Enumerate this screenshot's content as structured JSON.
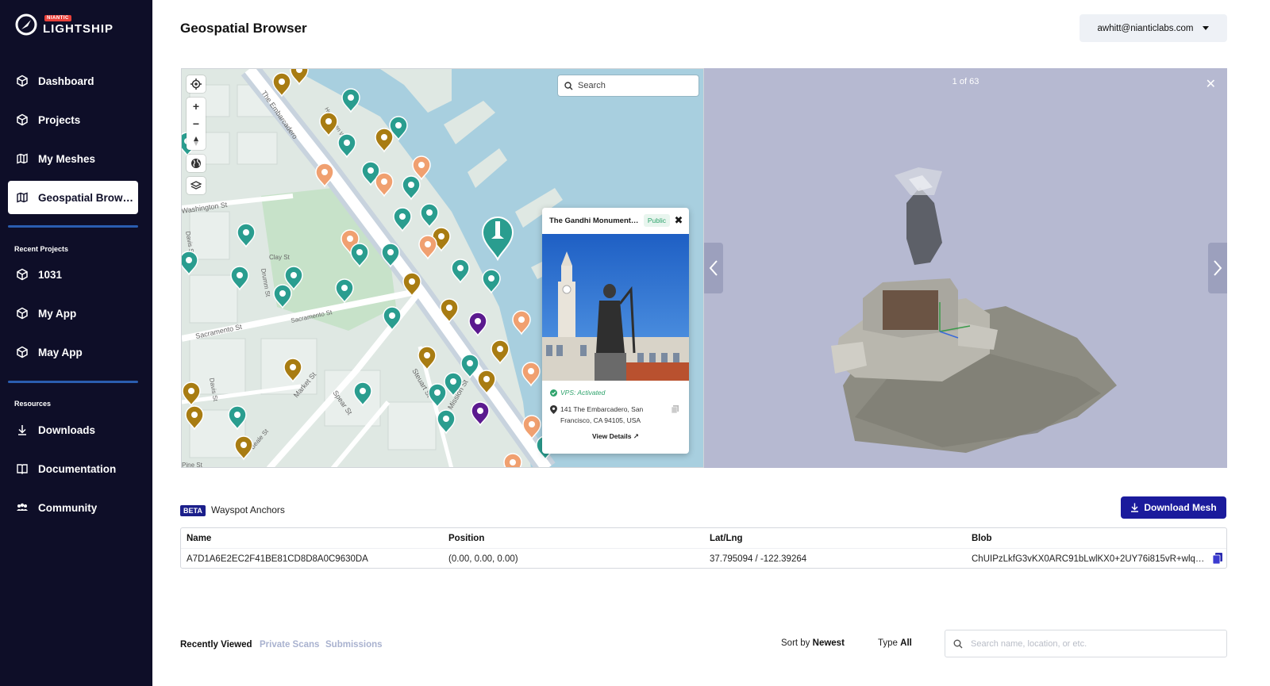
{
  "brand": {
    "sup": "NIANTIC",
    "name": "LIGHTSHIP"
  },
  "nav": {
    "dashboard": "Dashboard",
    "projects": "Projects",
    "my_meshes": "My Meshes",
    "geospatial": "Geospatial Browser"
  },
  "recent_projects": {
    "title": "Recent Projects",
    "items": [
      "1031",
      "My App",
      "May App"
    ]
  },
  "resources": {
    "title": "Resources",
    "downloads": "Downloads",
    "documentation": "Documentation",
    "community": "Community"
  },
  "header": {
    "title": "Geospatial Browser",
    "account": "awhitt@nianticlabs.com"
  },
  "map": {
    "search_placeholder": "Search",
    "streets": [
      "The Embarcadero",
      "Herb Caen Way",
      "Washington St",
      "Davis St",
      "Clay St",
      "Drumm St",
      "Sacramento St",
      "Market St",
      "Spear St",
      "Steuart St",
      "Mission St",
      "Beale St",
      "Pine St"
    ]
  },
  "popup": {
    "title": "The Gandhi Monument a...",
    "badge": "Public",
    "vps": "VPS: Activated",
    "address": "141 The Embarcadero, San Francisco, CA 94105, USA",
    "view_details": "View Details"
  },
  "viewer": {
    "count": "1 of 63"
  },
  "anchors": {
    "beta": "BETA",
    "title": "Wayspot Anchors",
    "download": "Download Mesh",
    "columns": [
      "Name",
      "Position",
      "Lat/Lng",
      "Blob"
    ],
    "row": {
      "name": "A7D1A6E2EC2F41BE81CD8D8A0C9630DA",
      "position": "(0.00, 0.00, 0.00)",
      "latlng": "37.795094 / -122.39264",
      "blob": "ChUIPzLkfG3vKX0ARC91bLwlKX0+2UY76i815vR+wlqKA..."
    }
  },
  "bottom": {
    "tabs": [
      "Recently Viewed",
      "Private Scans",
      "Submissions"
    ],
    "sort_label": "Sort by",
    "sort_value": "Newest",
    "type_label": "Type",
    "type_value": "All",
    "search_placeholder": "Search name, location, or etc."
  },
  "colors": {
    "sidebar": "#0e0e28",
    "teal_pin": "#2a9d8f",
    "gold_pin": "#a87c12",
    "orange_pin": "#f0a070",
    "purple_pin": "#5b1a8f",
    "primary_button": "#1b1b9c"
  }
}
